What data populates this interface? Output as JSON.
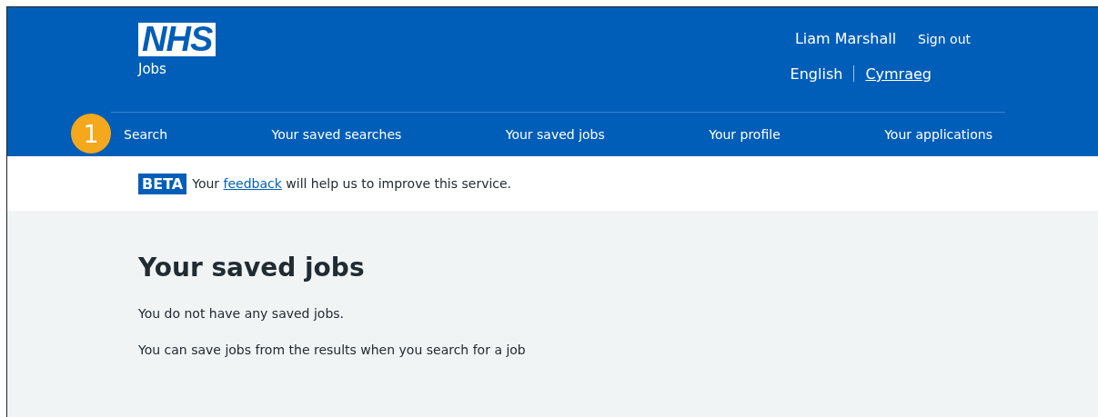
{
  "header": {
    "logo": "NHS",
    "service": "Jobs",
    "user": "Liam Marshall",
    "sign_out": "Sign out",
    "languages": [
      {
        "label": "English",
        "selected": true
      },
      {
        "label": "Cymraeg",
        "selected": false
      }
    ]
  },
  "nav": [
    {
      "label": "Search"
    },
    {
      "label": "Your saved searches"
    },
    {
      "label": "Your saved jobs"
    },
    {
      "label": "Your profile"
    },
    {
      "label": "Your applications"
    }
  ],
  "callout": "1",
  "beta": {
    "tag": "BETA",
    "before": "Your ",
    "link": "feedback",
    "after": " will help us to improve this service."
  },
  "main": {
    "heading": "Your saved jobs",
    "paragraphs": [
      "You do not have any saved jobs.",
      "You can save jobs from the results when you search for a job"
    ]
  }
}
